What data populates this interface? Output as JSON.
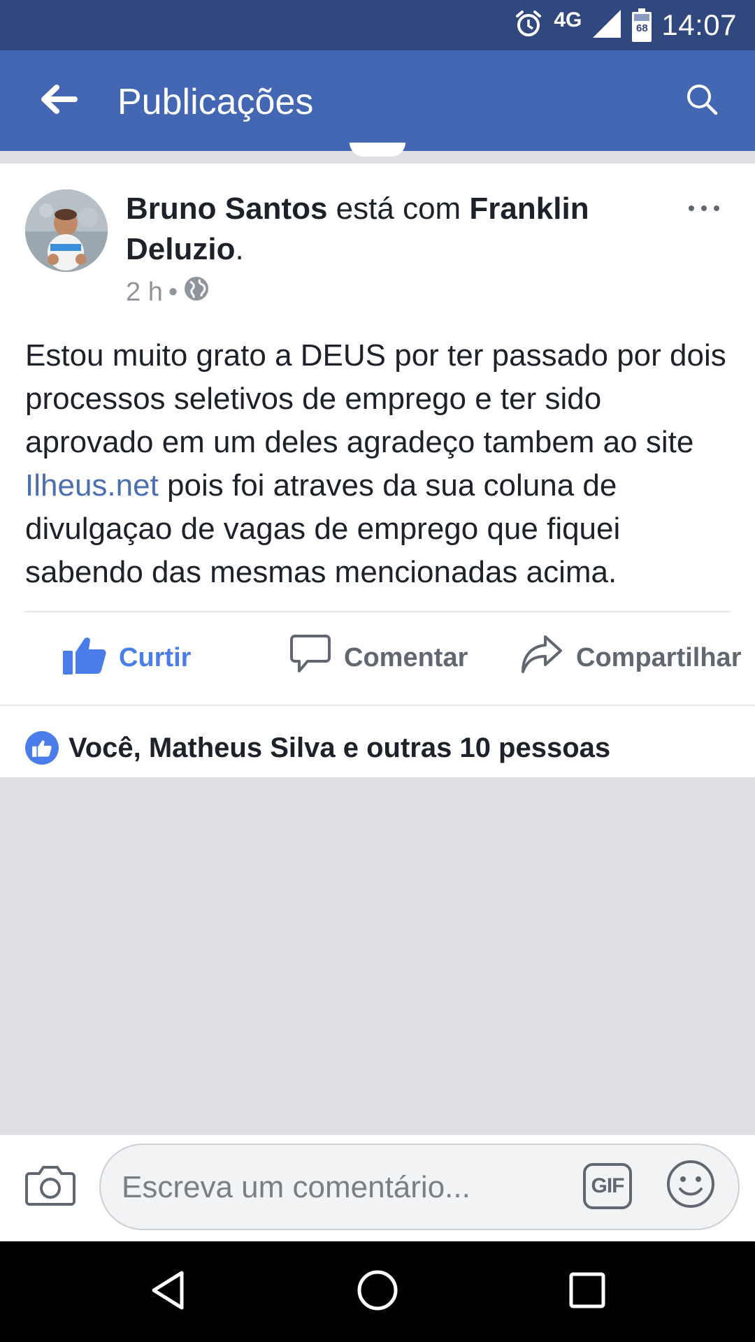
{
  "status_bar": {
    "time": "14:07",
    "network": "4G",
    "battery_level": "68",
    "icons": [
      "alarm-icon",
      "signal-icon",
      "battery-icon"
    ]
  },
  "app_bar": {
    "title": "Publicações",
    "icons": [
      "back-arrow-icon",
      "search-icon"
    ]
  },
  "post": {
    "author": "Bruno Santos",
    "with_text": " está com ",
    "tagged": "Franklin Deluzio",
    "period": ".",
    "time": "2 h",
    "separator": "•",
    "privacy_icon": "globe-icon",
    "body_before_link": "Estou muito grato a DEUS por ter passado por dois processos seletivos de emprego e ter sido aprovado em um deles agradeço tambem ao site ",
    "body_link": "Ilheus.net",
    "body_after_link": " pois foi atraves da sua coluna de divulgaçao de vagas de emprego que fiquei sabendo das mesmas mencionadas acima."
  },
  "actions": {
    "like": "Curtir",
    "comment": "Comentar",
    "share": "Compartilhar"
  },
  "likes_summary": "Você, Matheus Silva e outras 10 pessoas",
  "composer": {
    "placeholder": "Escreva um comentário...",
    "gif_label": "GIF"
  },
  "colors": {
    "status_bar": "#30487e",
    "app_bar": "#4367b3",
    "like_blue": "#4b7dea",
    "link": "#4c6fb0"
  }
}
